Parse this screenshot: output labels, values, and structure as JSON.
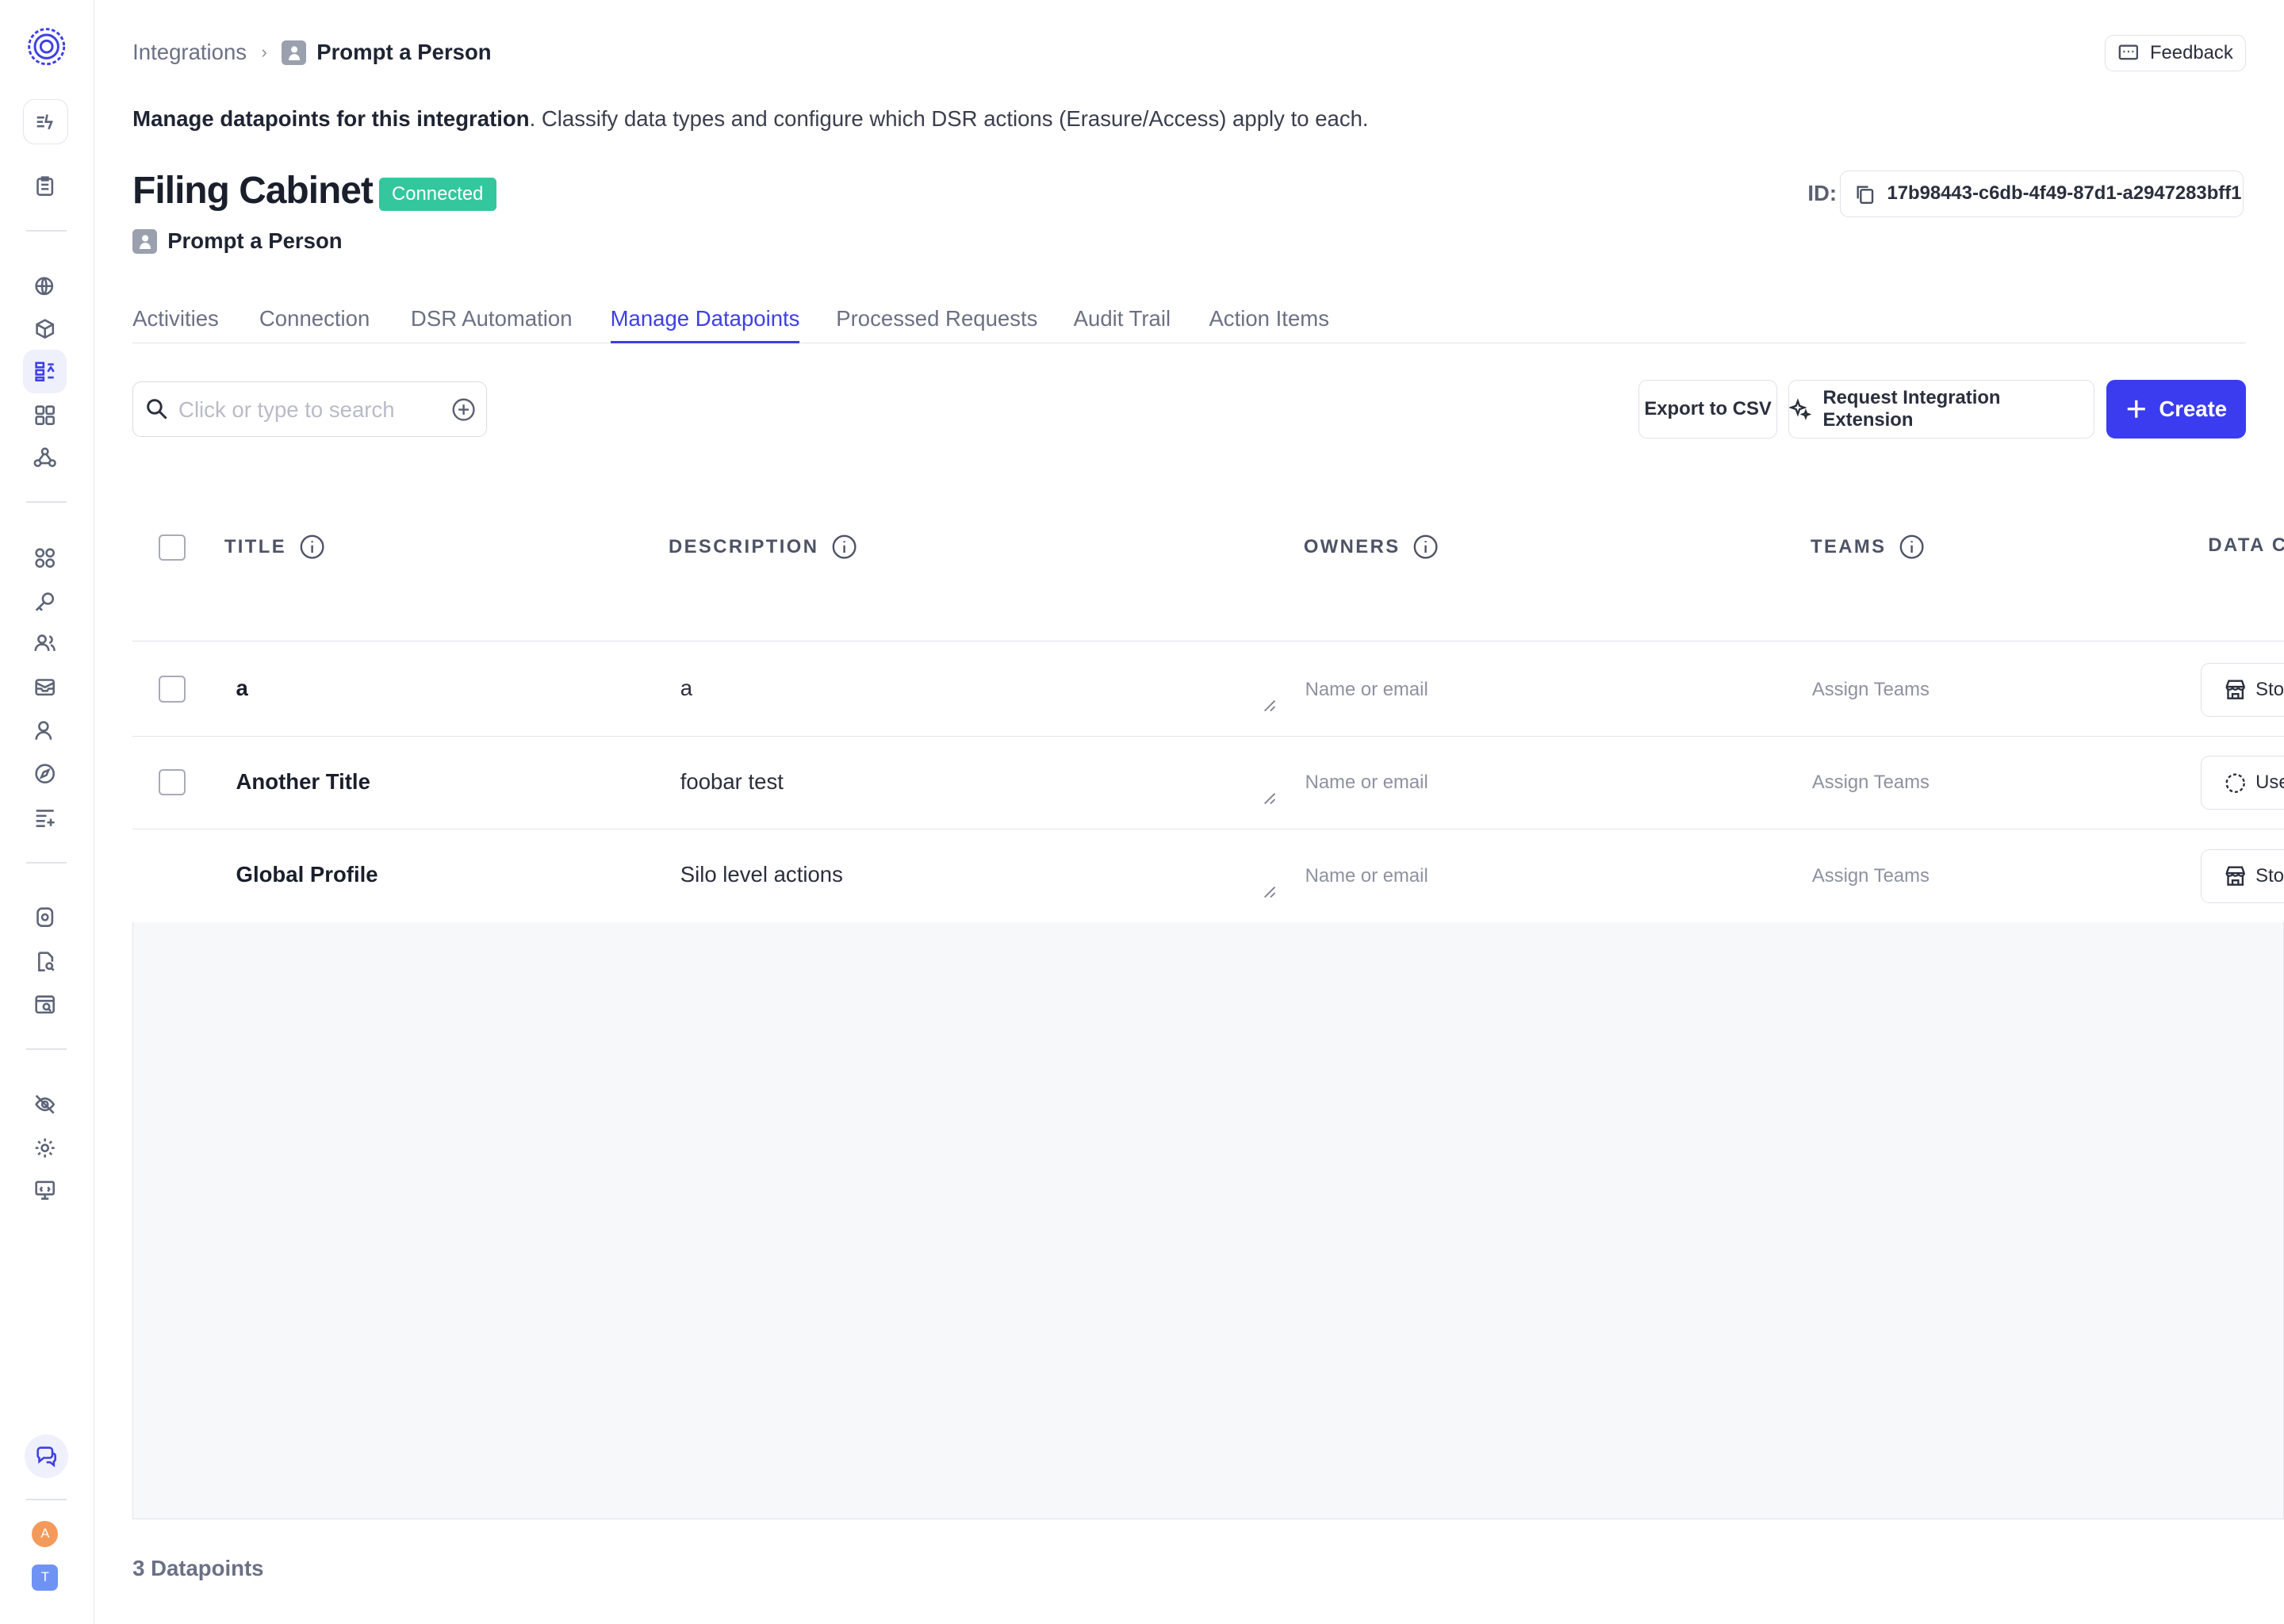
{
  "breadcrumb": {
    "parent": "Integrations",
    "current": "Prompt a Person"
  },
  "header": {
    "feedback_label": "Feedback",
    "intro_bold": "Manage datapoints for this integration",
    "intro_rest": ". Classify data types and configure which DSR actions (Erasure/Access) apply to each.",
    "title": "Filing Cabinet",
    "status_badge": "Connected",
    "subtitle": "Prompt a Person",
    "id_label": "ID:",
    "id_value": "17b98443-c6db-4f49-87d1-a2947283bff1"
  },
  "tabs": [
    "Activities",
    "Connection",
    "DSR Automation",
    "Manage Datapoints",
    "Processed Requests",
    "Audit Trail",
    "Action Items"
  ],
  "active_tab": "Manage Datapoints",
  "toolbar": {
    "search_placeholder": "Click or type to search",
    "export_label": "Export to CSV",
    "request_label": "Request Integration Extension",
    "create_label": "Create"
  },
  "table": {
    "columns": [
      "TITLE",
      "DESCRIPTION",
      "OWNERS",
      "TEAMS",
      "DATA CO"
    ],
    "rows": [
      {
        "title": "a",
        "description": "a",
        "owners_placeholder": "Name or email",
        "teams_placeholder": "Assign Teams",
        "category": "Sto",
        "category_icon": "store-icon",
        "has_checkbox": true
      },
      {
        "title": "Another Title",
        "description": "foobar test",
        "owners_placeholder": "Name or email",
        "teams_placeholder": "Assign Teams",
        "category": "Use",
        "category_icon": "dashed-circle-icon",
        "has_checkbox": true
      },
      {
        "title": "Global Profile",
        "description": "Silo level actions",
        "owners_placeholder": "Name or email",
        "teams_placeholder": "Assign Teams",
        "category": "Sto",
        "category_icon": "store-icon",
        "has_checkbox": false
      }
    ]
  },
  "footer": {
    "count": "3 Datapoints"
  },
  "sidebar": {
    "avatars": [
      "A",
      "T"
    ],
    "avatar_colors": [
      "#f39a5a",
      "#6f93f5"
    ]
  },
  "colors": {
    "accent": "#3d3fe5",
    "connected": "#34c79d",
    "create_button": "#3b3cf0"
  }
}
